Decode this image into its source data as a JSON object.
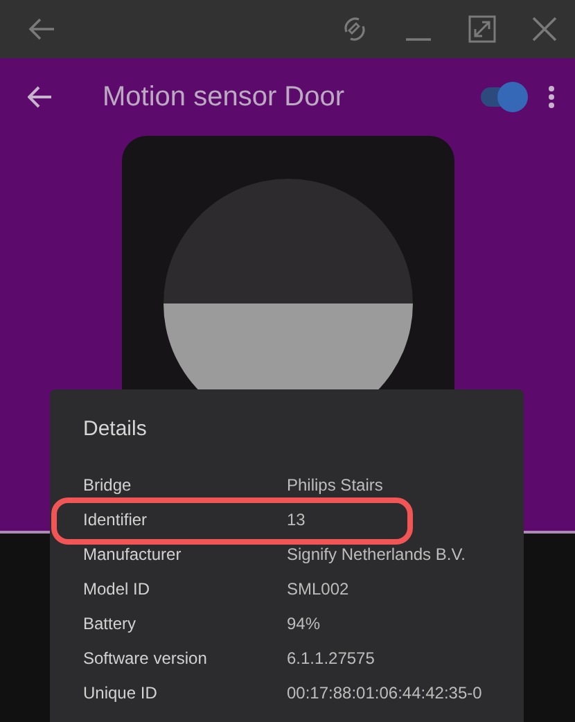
{
  "app_bar": {
    "title": "Motion sensor Door",
    "enabled": true
  },
  "dialog": {
    "title": "Details",
    "rows": [
      {
        "label": "Bridge",
        "value": "Philips Stairs",
        "highlighted": false
      },
      {
        "label": "Identifier",
        "value": "13",
        "highlighted": true
      },
      {
        "label": "Manufacturer",
        "value": "Signify Netherlands B.V.",
        "highlighted": false
      },
      {
        "label": "Model ID",
        "value": "SML002",
        "highlighted": false
      },
      {
        "label": "Battery",
        "value": "94%",
        "highlighted": false
      },
      {
        "label": "Software version",
        "value": "6.1.1.27575",
        "highlighted": false
      },
      {
        "label": "Unique ID",
        "value": "00:17:88:01:06:44:42:35-0",
        "highlighted": false
      }
    ]
  }
}
